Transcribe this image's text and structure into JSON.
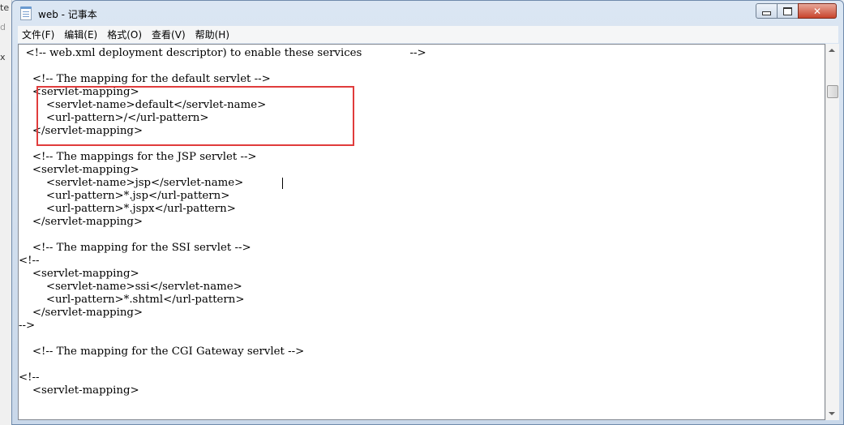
{
  "background": {
    "fragments": [
      "te",
      "d",
      "x"
    ]
  },
  "window": {
    "title": "web - 记事本",
    "close_symbol": "✕"
  },
  "menu": [
    "文件(F)",
    "编辑(E)",
    "格式(O)",
    "查看(V)",
    "帮助(H)"
  ],
  "editor": {
    "lines": [
      "  <!-- web.xml deployment descriptor) to enable these services              -->",
      "",
      "    <!-- The mapping for the default servlet -->",
      "    <servlet-mapping>",
      "        <servlet-name>default</servlet-name>",
      "        <url-pattern>/</url-pattern>",
      "    </servlet-mapping>",
      "",
      "    <!-- The mappings for the JSP servlet -->",
      "    <servlet-mapping>",
      "        <servlet-name>jsp</servlet-name>",
      "        <url-pattern>*.jsp</url-pattern>",
      "        <url-pattern>*.jspx</url-pattern>",
      "    </servlet-mapping>",
      "",
      "    <!-- The mapping for the SSI servlet -->",
      "<!--",
      "    <servlet-mapping>",
      "        <servlet-name>ssi</servlet-name>",
      "        <url-pattern>*.shtml</url-pattern>",
      "    </servlet-mapping>",
      "-->",
      "",
      "    <!-- The mapping for the CGI Gateway servlet -->",
      "",
      "<!--",
      "    <servlet-mapping>"
    ]
  },
  "annotation_color": "#e03c3c"
}
